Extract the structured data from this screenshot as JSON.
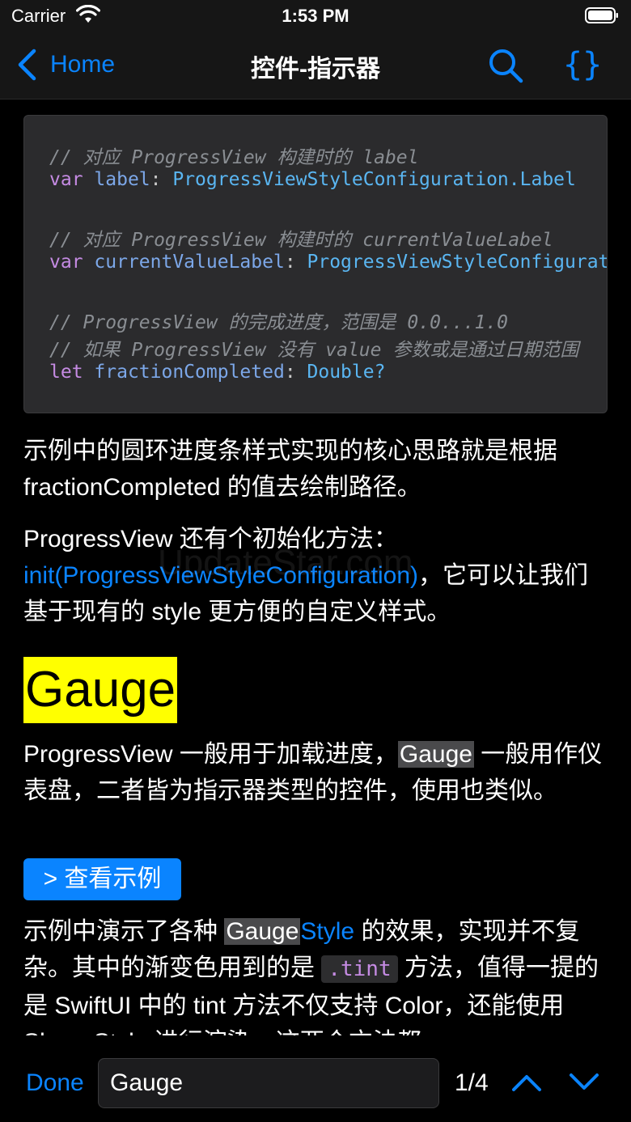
{
  "status_bar": {
    "carrier": "Carrier",
    "time": "1:53 PM"
  },
  "nav": {
    "back_label": "Home",
    "title": "控件-指示器"
  },
  "code": {
    "line1": "// 对应 ProgressView 构建时的 label",
    "line2_kw": "var",
    "line2_var": "label",
    "line2_type": "ProgressViewStyleConfiguration.Label",
    "line3": "// 对应 ProgressView 构建时的 currentValueLabel",
    "line4_kw": "var",
    "line4_var": "currentValueLabel",
    "line4_type": "ProgressViewStyleConfiguration.CurrentValueLabel",
    "line5": "// ProgressView 的完成进度，范围是 0.0...1.0",
    "line6": "// 如果 ProgressView 没有 value 参数或是通过日期范围",
    "line7_kw": "let",
    "line7_var": "fractionCompleted",
    "line7_type": "Double?"
  },
  "para1": "示例中的圆环进度条样式实现的核心思路就是根据 fractionCompleted 的值去绘制路径。",
  "para2": {
    "prefix": "ProgressView 还有个初始化方法：",
    "link": "init(ProgressViewStyleConfiguration)",
    "suffix": "，它可以让我们基于现有的 style 更方便的自定义样式。"
  },
  "watermark": "UpdateStar.com",
  "heading": "Gauge",
  "para3": {
    "prefix": "ProgressView 一般用于加载进度，",
    "highlight": "Gauge",
    "suffix": " 一般用作仪表盘，二者皆为指示器类型的控件，使用也类似。"
  },
  "example_button": "> 查看示例",
  "para4": {
    "prefix": "示例中演示了各种 ",
    "highlight": "Gauge",
    "link": "Style",
    "mid": " 的效果，实现并不复杂。其中的渐变色用到的是 ",
    "code": ".tint",
    "suffix": " 方法，值得一提的是 SwiftUI 中的 tint 方法不仅支持 Color，还能使用 ShapeStyle 进行渲染，这两个方法都"
  },
  "find_bar": {
    "done_label": "Done",
    "query": "Gauge",
    "count": "1/4"
  },
  "colors": {
    "accent": "#0a84ff",
    "highlight": "#ffff00",
    "background": "#000000"
  }
}
